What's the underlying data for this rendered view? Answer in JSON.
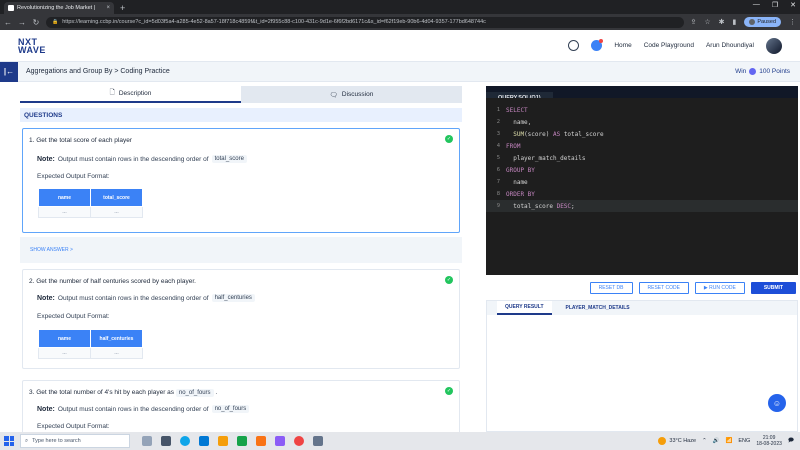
{
  "browser": {
    "tab_title": "Revolutionizing the Job Market |",
    "tab_close": "×",
    "new_tab": "+",
    "url": "https://learning.ccbp.in/course?c_id=5d03f5a4-a285-4e52-8a57-18f718c4859f&t_id=2f955c88-c100-431c-9d1e-6f6f2bd6171c&s_id=f62f19eb-90b6-4d04-9357-177bd648744c",
    "paused_label": "Paused"
  },
  "header": {
    "logo_line1": "NXT",
    "logo_line2": "WAVE",
    "nav_home": "Home",
    "nav_playground": "Code Playground",
    "user_name": "Arun Dhoundiyal"
  },
  "crumb": {
    "toggle": "|←",
    "path": "Aggregations and Group By > Coding Practice",
    "win_prefix": "Win",
    "win_points": "100 Points"
  },
  "left": {
    "tab_description": "Description",
    "tab_discussion": "Discussion",
    "questions_header": "QUESTIONS",
    "show_answer": "SHOW ANSWER >",
    "questions": [
      {
        "title": "1.  Get the total score of each player",
        "note_label": "Note:",
        "note_text": "Output must contain rows in the descending order of",
        "note_code": "total_score",
        "expected": "Expected Output Format:",
        "columns": [
          "name",
          "total_score"
        ],
        "cells": [
          "...",
          "..."
        ]
      },
      {
        "title": "2.  Get the number of half centuries scored by each player.",
        "note_label": "Note:",
        "note_text": "Output must contain rows in the descending order of",
        "note_code": "half_centuries",
        "expected": "Expected Output Format:",
        "columns": [
          "name",
          "half_centuries"
        ],
        "cells": [
          "...",
          "..."
        ]
      },
      {
        "title": "3.  Get the total number of 4's hit by each player as",
        "title_code": "no_of_fours",
        "title_end": ".",
        "note_label": "Note:",
        "note_text": "Output must contain rows in the descending order of",
        "note_code": "no_of_fours",
        "expected": "Expected Output Format:"
      }
    ]
  },
  "editor": {
    "tab": "QUERY.SQL(Q1)",
    "lines": [
      {
        "n": "1",
        "parts": [
          [
            "kw",
            "SELECT"
          ]
        ]
      },
      {
        "n": "2",
        "parts": [
          [
            "var",
            "  name,"
          ]
        ]
      },
      {
        "n": "3",
        "parts": [
          [
            "fn",
            "  SUM"
          ],
          [
            "var",
            "(score) "
          ],
          [
            "kw",
            "AS"
          ],
          [
            "var",
            " total_score"
          ]
        ]
      },
      {
        "n": "4",
        "parts": [
          [
            "kw",
            "FROM"
          ]
        ]
      },
      {
        "n": "5",
        "parts": [
          [
            "var",
            "  player_match_details"
          ]
        ]
      },
      {
        "n": "6",
        "parts": [
          [
            "kw",
            "GROUP BY"
          ]
        ]
      },
      {
        "n": "7",
        "parts": [
          [
            "var",
            "  name"
          ]
        ]
      },
      {
        "n": "8",
        "parts": [
          [
            "kw",
            "ORDER BY"
          ]
        ]
      },
      {
        "n": "9",
        "parts": [
          [
            "var",
            "  total_score "
          ],
          [
            "kw",
            "DESC"
          ],
          [
            "var",
            ";"
          ]
        ]
      }
    ],
    "btn_reset_db": "RESET DB",
    "btn_reset_code": "RESET CODE",
    "btn_run": "▶ RUN CODE",
    "btn_submit": "SUBMIT",
    "result_tab1": "QUERY RESULT",
    "result_tab2": "PLAYER_MATCH_DETAILS"
  },
  "taskbar": {
    "search_placeholder": "Type here to search",
    "weather": "33°C  Haze",
    "lang": "ENG",
    "time": "21:09",
    "date": "18-08-2023"
  }
}
